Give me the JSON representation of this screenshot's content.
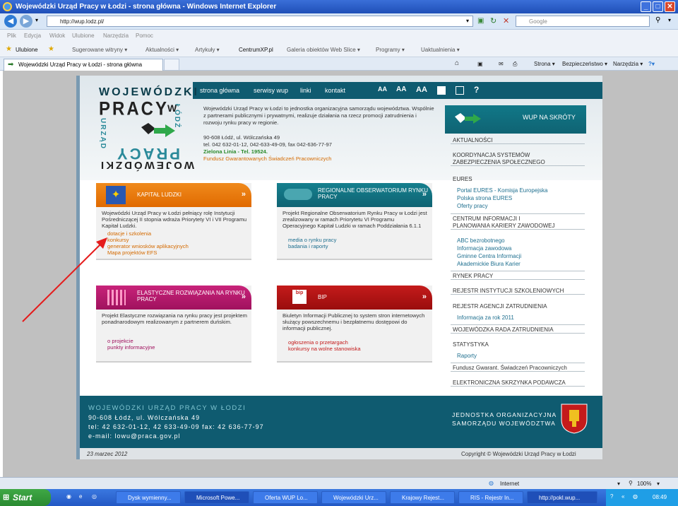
{
  "window": {
    "title": "Wojewódzki Urząd Pracy w Łodzi - strona główna - Windows Internet Explorer"
  },
  "address": {
    "url": "http://wup.lodz.pl/",
    "search_placeholder": "Google"
  },
  "menu": [
    "Plik",
    "Edycja",
    "Widok",
    "Ulubione",
    "Narzędzia",
    "Pomoc"
  ],
  "favorites": {
    "label": "Ulubione",
    "items": [
      "Sugerowane witryny ▾",
      "Aktualności ▾",
      "Artykuły ▾",
      "CentrumXP.pl",
      "Galeria obiektów Web Slice ▾",
      "Programy ▾",
      "Uaktualnienia ▾"
    ]
  },
  "tab": {
    "title": "Wojewódzki Urząd Pracy w Łodzi - strona główna"
  },
  "toolbar": {
    "strona": "Strona ▾",
    "bezpieczenstwo": "Bezpieczeństwo ▾",
    "narzedzia": "Narzędzia ▾"
  },
  "site": {
    "nav": [
      "strona główna",
      "serwisy wup",
      "linki",
      "kontakt"
    ],
    "size_icons": [
      "AA",
      "AA",
      "AA"
    ],
    "logo": {
      "top": "WOJEWÓDZKI",
      "pracy": "PRACY",
      "vert1": "URZĄD",
      "vert2": "ŁÓDŹ",
      "bottom": "WOJEWÓDZKI",
      "mid": "PRACY",
      "w": "W"
    },
    "intro": "Wojewódzki Urząd Pracy w Łodzi to jednostka organizacyjna samorządu województwa. Wspólnie z partnerami publicznymi i prywatnymi, realizuje działania na rzecz promocji zatrudnienia i rozwoju rynku pracy w regionie.",
    "address_line": "90-608 Łódź, ul. Wólczańska 49",
    "phones": "tel. 042 632-01-12, 042-633-49-09, fax 042-636-77-97",
    "green_line": "Zielona Linia - Tel. 19524.",
    "fund": "Fundusz Gwarantowanych Świadczeń Pracowniczych",
    "cards": [
      {
        "title": "KAPITAŁ LUDZKI",
        "body": "Wojewódzki Urząd Pracy w Łodzi pełniący rolę Instytucji Pośredniczącej II stopnia wdraża Priorytety VI i VII Programu Kapitał Ludzki.",
        "links": [
          "dotacje i szkolenia",
          "konkursy",
          "generator wniosków aplikacyjnych",
          "Mapa projektów EFS"
        ]
      },
      {
        "title": "REGIONALNE OBSERWATORIUM RYNKU PRACY",
        "body": "Projekt Regionalne Obserwatorium Rynku Pracy w Łodzi jest zrealizowany w ramach Priorytetu VI Programu Operacyjnego Kapitał Ludzki w ramach Poddziałania 6.1.1",
        "links": [
          "media o rynku pracy",
          "badania i raporty"
        ]
      },
      {
        "title": "ELASTYCZNE ROZWIĄZANIA NA RYNKU PRACY",
        "body": "Projekt Elastyczne rozwiązania na rynku pracy jest projektem ponadnarodowym realizowanym z partnerem duńskim.",
        "links": [
          "o projekcie",
          "punkty informacyjne"
        ]
      },
      {
        "title": "BIP",
        "body": "Biuletyn Informacji Publicznej to system stron internetowych służący powszechnemu i bezpłatnemu dostępowi do informacji publicznej.",
        "links": [
          "ogłoszenia o przetargach",
          "konkursy na wolne stanowiska"
        ]
      }
    ],
    "bip_tag": "bip",
    "sidebar": {
      "head": "WUP NA SKRÓTY",
      "items": [
        "AKTUALNOŚCI",
        "KOORDYNACJA SYSTEMÓW",
        "ZABEZPIECZENIA SPOŁECZNEGO",
        "EURES",
        "CENTRUM INFORMACJI I",
        "PLANOWANIA KARIERY ZAWODOWEJ",
        "RYNEK PRACY",
        "REJESTR INSTYTUCJI SZKOLENIOWYCH",
        "REJESTR AGENCJI ZATRUDNIENIA",
        "WOJEWÓDZKA RADA ZATRUDNIENIA",
        "STATYSTYKA",
        "Fundusz Gwarant. Świadczeń Pracowniczych",
        "ELEKTRONICZNA SKRZYNKA PODAWCZA"
      ],
      "eures_links": [
        "Portal EURES - Komisja Europejska",
        "Polska strona EURES",
        "Oferty pracy"
      ],
      "cikz_links": [
        "ABC bezrobotnego",
        "Informacja zawodowa",
        "Gminne Centra Informacji",
        "Akademickie Biura Karier"
      ],
      "raz_link": "Informacja za rok 2011",
      "stat_link": "Raporty"
    },
    "footer": {
      "name": "WOJEWÓDZKI URZĄD PRACY W ŁODZI",
      "addr": "90-608 Łódź, ul. Wólczańska 49",
      "phones": "tel: 42 632-01-12, 42 633-49-09 fax: 42 636-77-97",
      "email": "e-mail: lowu@praca.gov.pl",
      "org1": "JEDNOSTKA ORGANIZACYJNA",
      "org2": "SAMORZĄDU WOJEWÓDZTWA",
      "date": "23 marzec 2012",
      "copyright": "Copyright © Wojewódzki Urząd Pracy w Łodzi"
    }
  },
  "status": {
    "zone": "Internet",
    "zoom": "100%"
  },
  "taskbar": {
    "start": "Start",
    "tasks": [
      "Dysk wymienny...",
      "Microsoft Powe...",
      "Oferta WUP Lo...",
      "Wojewódzki Urz...",
      "Krajowy Rejest...",
      "RIS - Rejestr In...",
      "http://pokl.wup..."
    ],
    "time": "08:49"
  }
}
